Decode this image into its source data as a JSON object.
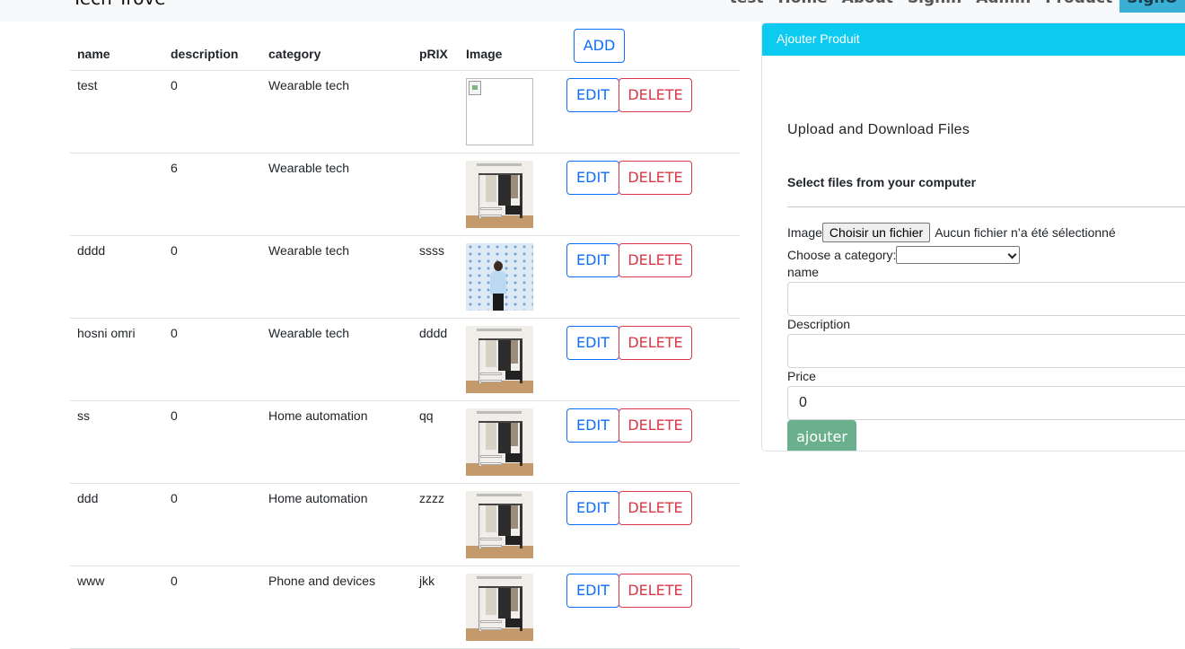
{
  "navbar": {
    "brand": "Tech Trove",
    "items": [
      "test",
      "Home",
      "About",
      "Signin",
      "Admin",
      "Product",
      "SignO"
    ]
  },
  "table": {
    "add_label": "ADD",
    "headers": [
      "name",
      "description",
      "category",
      "pRIX",
      "Image"
    ],
    "edit_label": "EDIT",
    "delete_label": "DELETE",
    "rows": [
      {
        "name": "test",
        "description": "0",
        "category": "Wearable tech",
        "prix": "",
        "image": "broken"
      },
      {
        "name": "",
        "description": "6",
        "category": "Wearable tech",
        "prix": "",
        "image": "rack"
      },
      {
        "name": "dddd",
        "description": "0",
        "category": "Wearable tech",
        "prix": "ssss",
        "image": "photo"
      },
      {
        "name": "hosni omri",
        "description": "0",
        "category": "Wearable tech",
        "prix": "dddd",
        "image": "rack"
      },
      {
        "name": "ss",
        "description": "0",
        "category": "Home automation",
        "prix": "qq",
        "image": "rack"
      },
      {
        "name": "ddd",
        "description": "0",
        "category": "Home automation",
        "prix": "zzzz",
        "image": "rack"
      },
      {
        "name": "www",
        "description": "0",
        "category": "Phone and devices",
        "prix": "jkk",
        "image": "rack"
      }
    ]
  },
  "form": {
    "header": "Ajouter Produit",
    "upload_title": "Upload and Download Files",
    "select_title": "Select files from your computer",
    "image_label": "Image",
    "file_button": "Choisir un fichier",
    "file_status": "Aucun fichier n’a été sélectionné",
    "category_label": "Choose a category:",
    "name_label": "name",
    "name_value": "",
    "description_label": "Description",
    "description_value": "",
    "price_label": "Price",
    "price_value": "0",
    "submit_label": "ajouter"
  },
  "colors": {
    "card_header": "#0dcaf0",
    "edit": "#0d6efd",
    "delete": "#dc3545",
    "ajouter": "#6bb08d",
    "nav_active": "#3ab0d6"
  }
}
